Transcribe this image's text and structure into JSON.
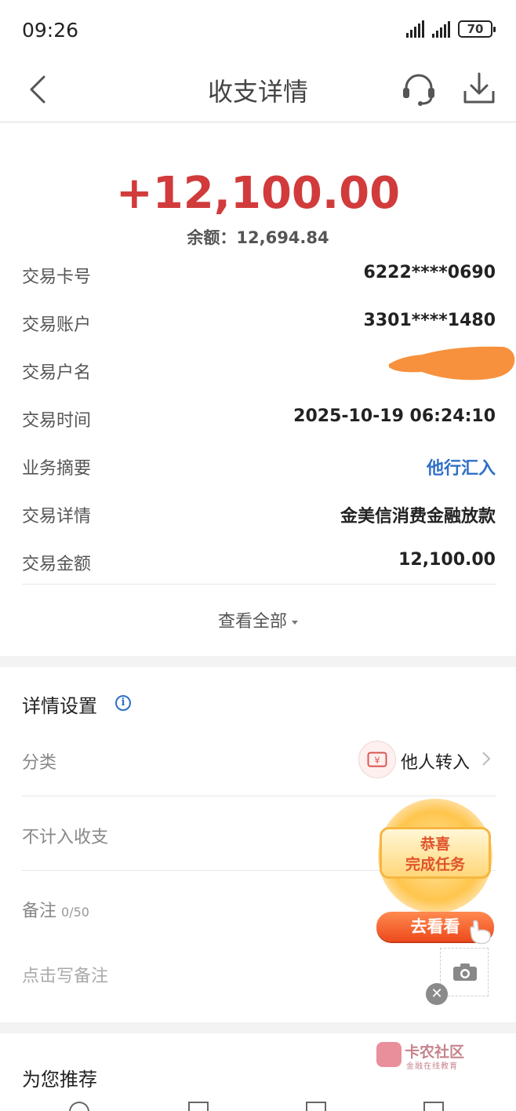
{
  "status_bar": {
    "time": "09:26",
    "battery": "70"
  },
  "nav": {
    "title": "收支详情"
  },
  "summary": {
    "amount": "+12,100.00",
    "balance_label": "余额：",
    "balance_value": "12,694.84",
    "amount_color": "#d13b3b"
  },
  "details": [
    {
      "label": "交易卡号",
      "value": "6222****0690"
    },
    {
      "label": "交易账户",
      "value": "3301****1480"
    },
    {
      "label": "交易户名",
      "value": ""
    },
    {
      "label": "交易时间",
      "value": "2025-10-19 06:24:10"
    },
    {
      "label": "业务摘要",
      "value": "他行汇入"
    },
    {
      "label": "交易详情",
      "value": "金美信消费金融放款"
    },
    {
      "label": "交易金额",
      "value": "12,100.00"
    }
  ],
  "view_all": "查看全部",
  "settings": {
    "title": "详情设置",
    "category_label": "分类",
    "category_value": "他人转入",
    "exclude_label": "不计入收支",
    "remark_label": "备注",
    "remark_count": "0/50",
    "remark_placeholder": "点击写备注"
  },
  "promo": {
    "line1": "恭喜",
    "line2": "完成任务",
    "button": "去看看"
  },
  "recommend": {
    "title": "为您推荐"
  },
  "watermark": {
    "name": "卡农社区",
    "sub": "金融在线教育"
  },
  "colors": {
    "link": "#2f6fc6",
    "accent_red": "#d13b3b",
    "promo_orange": "#ee4a1c"
  }
}
